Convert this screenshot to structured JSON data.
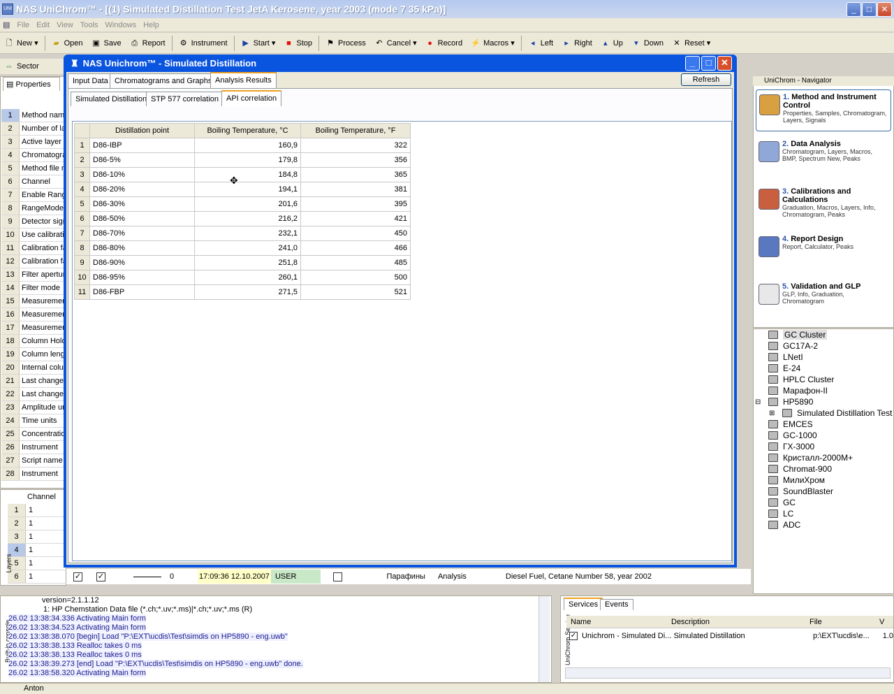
{
  "app": {
    "title": "NAS UniChrom™ - [(1) Simulated Distillation Test JetA Kerosene, year 2003 (mode 7 35 kPa)]",
    "icon_label": "UNI"
  },
  "menu": [
    "File",
    "Edit",
    "View",
    "Tools",
    "Windows",
    "Help"
  ],
  "toolbar": [
    {
      "label": "New",
      "icon": "new-icon"
    },
    {
      "label": "Open",
      "icon": "open-icon"
    },
    {
      "label": "Save",
      "icon": "save-icon"
    },
    {
      "label": "Report",
      "icon": "printer-icon"
    },
    {
      "label": "Instrument",
      "icon": "instrument-icon"
    },
    {
      "label": "Start",
      "icon": "play-icon"
    },
    {
      "label": "Stop",
      "icon": "stop-icon"
    },
    {
      "label": "Process",
      "icon": "process-icon"
    },
    {
      "label": "Cancel",
      "icon": "cancel-icon"
    },
    {
      "label": "Record",
      "icon": "record-icon"
    },
    {
      "label": "Macros",
      "icon": "macros-icon"
    },
    {
      "label": "Left",
      "icon": "left-icon"
    },
    {
      "label": "Right",
      "icon": "right-icon"
    },
    {
      "label": "Up",
      "icon": "up-icon"
    },
    {
      "label": "Down",
      "icon": "down-icon"
    },
    {
      "label": "Reset",
      "icon": "reset-icon"
    }
  ],
  "toolbar2": {
    "sector_label": "Sector"
  },
  "properties": {
    "tab_label": "Properties",
    "rows": [
      "Method name",
      "Number of la",
      "Active layer",
      "Chromatogra",
      "Method file n",
      "Channel",
      "Enable Rang",
      "RangeMode",
      "Detector sign",
      "Use calibratio",
      "Calibration fa",
      "Calibration fa",
      "Filter apertur",
      "Filter mode",
      "Measuremen",
      "Measuremen",
      "Measuremen",
      "Column Holde",
      "Column lengt",
      "Internal colur",
      "Last change",
      "Last change",
      "Amplitude ur",
      "Time units",
      "Concentratio",
      "Instrument",
      "Script name",
      "Instrument"
    ]
  },
  "channels": {
    "header": "Channel",
    "rows": [
      "1",
      "1",
      "1",
      "1",
      "1",
      "1"
    ],
    "side_label": "Layers"
  },
  "layer_row": {
    "zero": "0",
    "time": "17:09:36 12.10.2007",
    "user": "USER",
    "name": "Парафины",
    "kind": "Analysis",
    "description": "Diesel Fuel, Cetane Number 58, year 2002"
  },
  "dialog": {
    "title": "NAS Unichrom™ - Simulated Distillation",
    "tabs": [
      "Input Data",
      "Chromatograms and Graphs",
      "Analysis Results"
    ],
    "subtabs": [
      "Simulated Distillation",
      "STP 577 correlation",
      "API correlation"
    ],
    "refresh_label": "Refresh",
    "table": {
      "headers": [
        "Distillation point",
        "Boiling Temperature, °C",
        "Boiling Temperature, °F"
      ],
      "rows": [
        {
          "n": "1",
          "point": "D86-IBP",
          "c": "160,9",
          "f": "322"
        },
        {
          "n": "2",
          "point": "D86-5%",
          "c": "179,8",
          "f": "356"
        },
        {
          "n": "3",
          "point": "D86-10%",
          "c": "184,8",
          "f": "365"
        },
        {
          "n": "4",
          "point": "D86-20%",
          "c": "194,1",
          "f": "381"
        },
        {
          "n": "5",
          "point": "D86-30%",
          "c": "201,6",
          "f": "395"
        },
        {
          "n": "6",
          "point": "D86-50%",
          "c": "216,2",
          "f": "421"
        },
        {
          "n": "7",
          "point": "D86-70%",
          "c": "232,1",
          "f": "450"
        },
        {
          "n": "8",
          "point": "D86-80%",
          "c": "241,0",
          "f": "466"
        },
        {
          "n": "9",
          "point": "D86-90%",
          "c": "251,8",
          "f": "485"
        },
        {
          "n": "10",
          "point": "D86-95%",
          "c": "260,1",
          "f": "500"
        },
        {
          "n": "11",
          "point": "D86-FBP",
          "c": "271,5",
          "f": "521"
        }
      ]
    }
  },
  "navigator": {
    "title": "UniChrom - Navigator",
    "items": [
      {
        "num": "1.",
        "title": "Method and Instrument Control",
        "sub": "Properties, Samples, Chromatogram, Layers, Signals"
      },
      {
        "num": "2.",
        "title": "Data Analysis",
        "sub": "Chromatogram, Layers, Macros, BMP, Spectrum New, Peaks"
      },
      {
        "num": "3.",
        "title": "Calibrations and Calculations",
        "sub": "Graduation, Macros, Layers, Info, Chromatogram, Peaks"
      },
      {
        "num": "4.",
        "title": "Report Design",
        "sub": "Report, Calculator, Peaks"
      },
      {
        "num": "5.",
        "title": "Validation and GLP",
        "sub": "GLP, Info, Graduation, Chromatogram"
      }
    ]
  },
  "tree": [
    "GC Cluster",
    "GC17A-2",
    "LNetI",
    "E-24",
    "HPLC Cluster",
    "Марафон-II",
    "HP5890",
    "Simulated Distillation Test",
    "EMCES",
    "GC-1000",
    "ГХ-3000",
    "Кристалл-2000М+",
    "Chromat-900",
    "МилиХром",
    "SoundBlaster",
    "GC",
    "LC",
    "ADC"
  ],
  "console": {
    "side_label": "Built-in console",
    "lines": [
      "version=2.1.1.12",
      "1: HP Chemstation Data file (*.ch;*.uv;*.ms)|*.ch;*.uv;*.ms (R)",
      "26.02 13:38:34.336 Activating Main form",
      "26.02 13:38:34.523 Activating Main form",
      "26.02 13:38:38.070 [begin] Load \"P:\\EXT\\ucdis\\Test\\simdis on HP5890 - eng.uwb\"",
      "26.02 13:38:38.133 Realloc takes 0 ms",
      "26.02 13:38:38.133 Realloc takes 0 ms",
      "26.02 13:38:39.273 [end] Load \"P:\\EXT\\ucdis\\Test\\simdis on HP5890 - eng.uwb\" done.",
      "26.02 13:38:58.320 Activating Main form"
    ]
  },
  "services": {
    "side_label": "UniChrom Service",
    "tabs": [
      "Services",
      "Events"
    ],
    "headers": [
      "Name",
      "Description",
      "File",
      "V"
    ],
    "row": {
      "name": "Unichrom - Simulated Di...",
      "description": "Simulated Distillation",
      "file": "p:\\EXT\\ucdis\\e...",
      "v": "1.0"
    }
  },
  "status": {
    "user": "Anton"
  },
  "colors": {
    "dialog_title": "#0a55e0",
    "accent": "#f0a020",
    "console_text": "#1a1a8c"
  }
}
